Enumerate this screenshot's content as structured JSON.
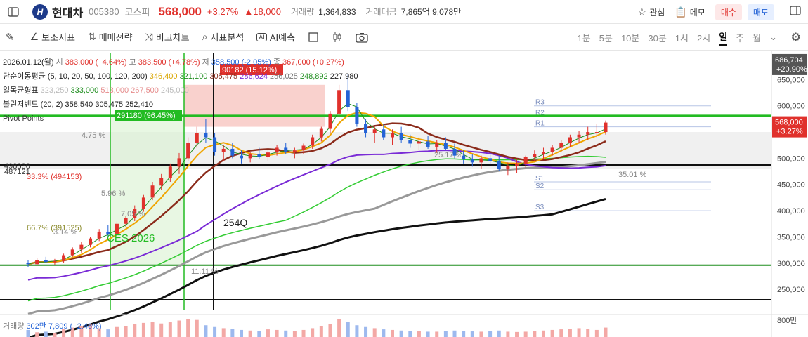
{
  "header": {
    "logo_text": "H",
    "name": "현대차",
    "code": "005380",
    "market": "코스피",
    "price": "568,000",
    "change_pct": "+3.27%",
    "change": "▲18,000",
    "volume_label": "거래량",
    "volume": "1,364,833",
    "amount_label": "거래대금",
    "amount": "7,865억 9,078만",
    "watch": "관심",
    "memo": "메모",
    "buy": "매수",
    "sell": "매도"
  },
  "toolbar": {
    "indicators": "보조지표",
    "strategy": "매매전략",
    "compare": "비교차트",
    "analysis": "지표분석",
    "ai": "AI예측",
    "periods": [
      "1분",
      "5분",
      "10분",
      "30분",
      "1시",
      "2시",
      "일",
      "주",
      "월"
    ],
    "active_period": "일"
  },
  "legend": {
    "date": "2026.01.12(월)",
    "open_l": "시",
    "open": "383,000 (+4.64%)",
    "high_l": "고",
    "high": "383,500 (+4.78%)",
    "low_l": "저",
    "low": "358,500 (-2.05%)",
    "close_l": "종",
    "close": "367,000 (+0.27%)",
    "ma_label": "단순이동평균 (5, 10, 20, 50, 100, 120, 200)",
    "ma_values": [
      "346,400",
      "321,100",
      "305,475",
      "286,624",
      "256,025",
      "248,892",
      "227,980"
    ],
    "ichimoku_label": "일목균형표",
    "ichimoku_values": [
      "323,250",
      "333,000",
      "513,000",
      "267,500",
      "245,000"
    ],
    "bb_label": "볼린저밴드 (20, 2)",
    "bb_values": [
      "358,540",
      "305,475",
      "252,410"
    ],
    "volume_label": "거래량",
    "volume_values": "302만 7,809 (−2.46%)"
  },
  "colors": {
    "up": "#e0312c",
    "down": "#2463d6",
    "ma5": "#f0a500",
    "ma10": "#1e8e1e",
    "ma20": "#8b2b1b",
    "ma50": "#7a2bd6",
    "ma100": "#999999",
    "ma120": "#33cc33",
    "ma200": "#111111"
  },
  "chart_data": {
    "type": "candlestick",
    "y_axis_ticks": [
      800000,
      700000,
      650000,
      600000,
      550000,
      500000,
      450000,
      400000,
      350000,
      300000,
      250000
    ],
    "y_axis_labels": [
      "800만",
      "",
      "650,000",
      "600,000",
      "550,000",
      "500,000",
      "450,000",
      "400,000",
      "350,000",
      "300,000",
      "250,000"
    ],
    "ylim": [
      210000,
      700000
    ],
    "price_tags": [
      {
        "label": "686,704",
        "sub": "+20.90%",
        "value": 686704,
        "color": "#555555"
      },
      {
        "label": "568,000",
        "sub": "+3.27%",
        "value": 568000,
        "color": "#e0312c"
      }
    ],
    "horizontal_levels": [
      {
        "value": 581000,
        "color": "#22bb22"
      },
      {
        "value": 487121,
        "color": "#111111"
      },
      {
        "value": 296000,
        "color": "#1e8e1e"
      },
      {
        "value": 230000,
        "color": "#111111"
      }
    ],
    "annotations": [
      {
        "text": "90182 (15.12%)",
        "box": "red"
      },
      {
        "text": "291180 (96.45%)",
        "box": "green"
      },
      {
        "text": "254Q",
        "box": "none"
      },
      {
        "text": "CES 2026",
        "box": "none"
      },
      {
        "text": "66.7% (391525)",
        "box": "none"
      },
      {
        "text": "33.3% (494153)",
        "box": "none"
      },
      {
        "text": "498836",
        "box": "none"
      },
      {
        "text": "487121",
        "box": "none"
      },
      {
        "text": "25.17 %",
        "box": "none"
      },
      {
        "text": "35.01 %",
        "box": "none"
      },
      {
        "text": "4.75 %",
        "box": "none"
      },
      {
        "text": "5.96 %",
        "box": "none"
      },
      {
        "text": "7.05 %",
        "box": "none"
      },
      {
        "text": "3.14 %",
        "box": "none"
      },
      {
        "text": "11.11 %",
        "box": "none"
      },
      {
        "text": "Pivot Points",
        "box": "none"
      },
      {
        "text": "R1",
        "box": "none"
      },
      {
        "text": "R2",
        "box": "none"
      },
      {
        "text": "R3",
        "box": "none"
      },
      {
        "text": "S1",
        "box": "none"
      },
      {
        "text": "S2",
        "box": "none"
      },
      {
        "text": "S3",
        "box": "none"
      }
    ],
    "candles": [
      [
        300000,
        305000,
        292000,
        298000
      ],
      [
        298000,
        310000,
        295000,
        306000
      ],
      [
        306000,
        312000,
        300000,
        302000
      ],
      [
        302000,
        308000,
        296000,
        304000
      ],
      [
        304000,
        318000,
        300000,
        315000
      ],
      [
        315000,
        330000,
        312000,
        326000
      ],
      [
        326000,
        340000,
        320000,
        335000
      ],
      [
        335000,
        350000,
        330000,
        347000
      ],
      [
        347000,
        365000,
        342000,
        360000
      ],
      [
        360000,
        372000,
        350000,
        356000
      ],
      [
        356000,
        380000,
        352000,
        375000
      ],
      [
        375000,
        390000,
        368000,
        386000
      ],
      [
        386000,
        410000,
        380000,
        404000
      ],
      [
        404000,
        430000,
        398000,
        425000
      ],
      [
        425000,
        455000,
        420000,
        448000
      ],
      [
        448000,
        470000,
        440000,
        462000
      ],
      [
        462000,
        490000,
        455000,
        484000
      ],
      [
        484000,
        510000,
        470000,
        500000
      ],
      [
        500000,
        540000,
        495000,
        530000
      ],
      [
        530000,
        560000,
        520000,
        548000
      ],
      [
        548000,
        575000,
        530000,
        540000
      ],
      [
        540000,
        548000,
        505000,
        512000
      ],
      [
        512000,
        525000,
        495000,
        518000
      ],
      [
        518000,
        530000,
        500000,
        505000
      ],
      [
        505000,
        515000,
        490000,
        500000
      ],
      [
        500000,
        512000,
        492000,
        508000
      ],
      [
        508000,
        520000,
        498000,
        503000
      ],
      [
        503000,
        515000,
        495000,
        511000
      ],
      [
        511000,
        525000,
        505000,
        520000
      ],
      [
        520000,
        530000,
        508000,
        512000
      ],
      [
        512000,
        520000,
        500000,
        515000
      ],
      [
        515000,
        528000,
        508000,
        524000
      ],
      [
        524000,
        545000,
        518000,
        540000
      ],
      [
        540000,
        560000,
        532000,
        556000
      ],
      [
        556000,
        590000,
        548000,
        585000
      ],
      [
        585000,
        640000,
        578000,
        630000
      ],
      [
        630000,
        660000,
        590000,
        598000
      ],
      [
        598000,
        605000,
        560000,
        566000
      ],
      [
        566000,
        575000,
        540000,
        548000
      ],
      [
        548000,
        560000,
        530000,
        555000
      ],
      [
        555000,
        565000,
        535000,
        540000
      ],
      [
        540000,
        555000,
        525000,
        548000
      ],
      [
        548000,
        560000,
        530000,
        535000
      ],
      [
        535000,
        545000,
        520000,
        528000
      ],
      [
        528000,
        540000,
        515000,
        532000
      ],
      [
        532000,
        542000,
        518000,
        522000
      ],
      [
        522000,
        535000,
        510000,
        530000
      ],
      [
        530000,
        540000,
        515000,
        518000
      ],
      [
        518000,
        528000,
        500000,
        505000
      ],
      [
        505000,
        515000,
        490000,
        498000
      ],
      [
        498000,
        508000,
        484000,
        492000
      ],
      [
        492000,
        505000,
        480000,
        500000
      ],
      [
        500000,
        512000,
        488000,
        495000
      ],
      [
        495000,
        505000,
        475000,
        480000
      ],
      [
        480000,
        492000,
        468000,
        486000
      ],
      [
        486000,
        498000,
        472000,
        490000
      ],
      [
        490000,
        505000,
        482000,
        502000
      ],
      [
        502000,
        515000,
        495000,
        508000
      ],
      [
        508000,
        520000,
        498000,
        512000
      ],
      [
        512000,
        525000,
        505000,
        520000
      ],
      [
        520000,
        535000,
        512000,
        530000
      ],
      [
        530000,
        545000,
        522000,
        540000
      ],
      [
        540000,
        552000,
        530000,
        545000
      ],
      [
        545000,
        560000,
        535000,
        550000
      ],
      [
        550000,
        565000,
        540000,
        550000
      ],
      [
        550000,
        572000,
        545000,
        568000
      ]
    ],
    "volume": [
      120,
      80,
      90,
      60,
      140,
      160,
      180,
      210,
      150,
      130,
      170,
      190,
      220,
      240,
      260,
      230,
      250,
      280,
      310,
      290,
      200,
      170,
      150,
      140,
      120,
      110,
      100,
      130,
      120,
      110,
      100,
      120,
      150,
      180,
      220,
      300,
      260,
      200,
      170,
      150,
      130,
      120,
      110,
      100,
      100,
      90,
      90,
      100,
      110,
      100,
      95,
      90,
      100,
      110,
      90,
      85,
      90,
      100,
      110,
      120,
      130,
      140,
      150,
      140,
      120,
      160
    ]
  }
}
